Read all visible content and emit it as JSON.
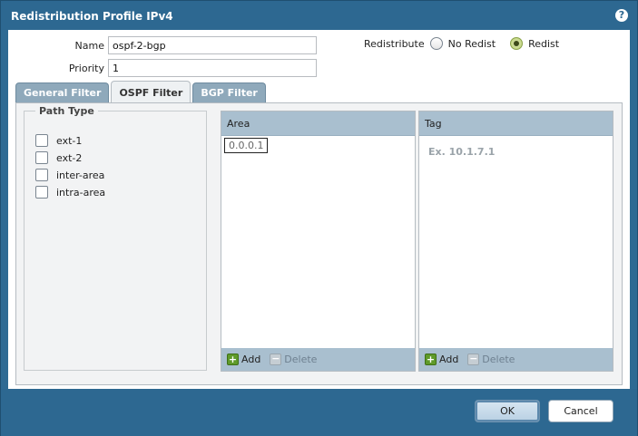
{
  "dialog": {
    "title": "Redistribution Profile IPv4",
    "help_glyph": "?"
  },
  "form": {
    "name_label": "Name",
    "name_value": "ospf-2-bgp",
    "priority_label": "Priority",
    "priority_value": "1",
    "redistribute_label": "Redistribute",
    "options": [
      {
        "label": "No Redist",
        "checked": false
      },
      {
        "label": "Redist",
        "checked": true
      }
    ]
  },
  "tabs": [
    {
      "label": "General Filter",
      "active": false
    },
    {
      "label": "OSPF Filter",
      "active": true
    },
    {
      "label": "BGP Filter",
      "active": false
    }
  ],
  "path_type": {
    "legend": "Path Type",
    "items": [
      {
        "label": "ext-1",
        "checked": false
      },
      {
        "label": "ext-2",
        "checked": false
      },
      {
        "label": "inter-area",
        "checked": false
      },
      {
        "label": "intra-area",
        "checked": false
      }
    ]
  },
  "area_grid": {
    "header": "Area",
    "editing_value": "0.0.0.1",
    "add_label": "Add",
    "delete_label": "Delete"
  },
  "tag_grid": {
    "header": "Tag",
    "placeholder": "Ex. 10.1.7.1",
    "add_label": "Add",
    "delete_label": "Delete"
  },
  "footer": {
    "ok_label": "OK",
    "cancel_label": "Cancel"
  }
}
